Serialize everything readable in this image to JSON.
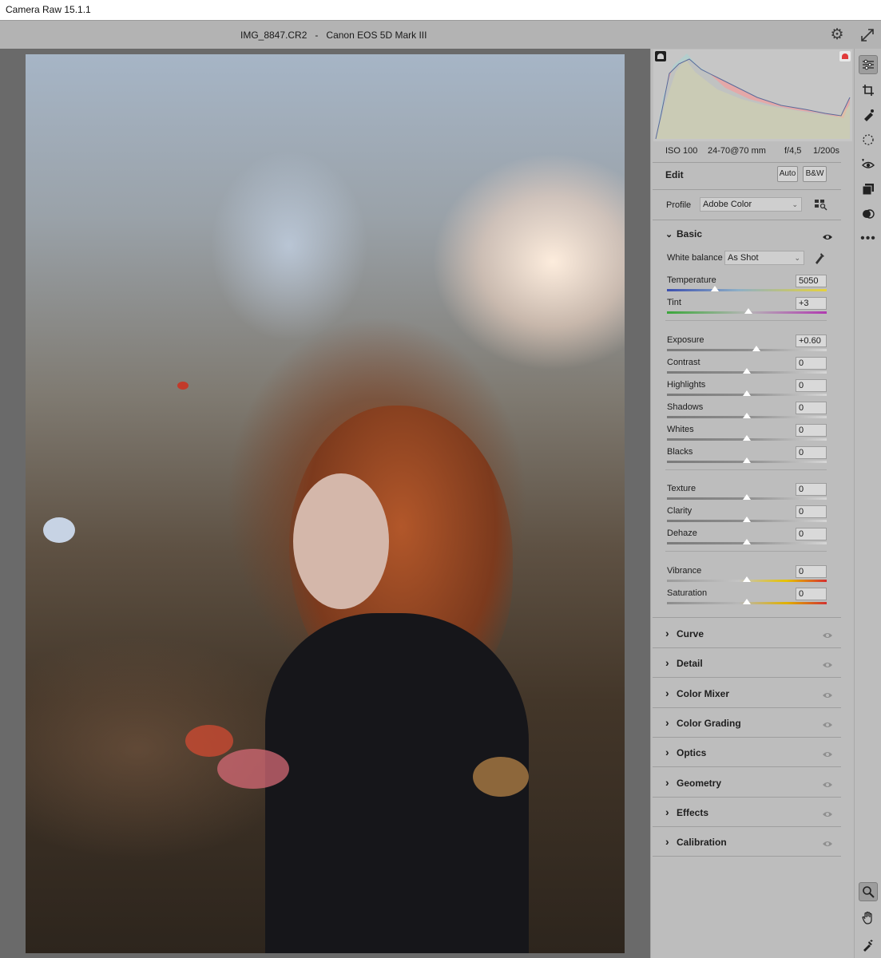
{
  "app": {
    "window_title": "Camera Raw 15.1.1"
  },
  "document": {
    "file_name": "IMG_8847.CR2",
    "separator": "-",
    "camera": "Canon EOS 5D Mark III"
  },
  "exif": {
    "iso": "ISO 100",
    "lens": "24-70@70 mm",
    "aperture": "f/4,5",
    "shutter": "1/200s"
  },
  "edit": {
    "title": "Edit",
    "auto_label": "Auto",
    "bw_label": "B&W"
  },
  "profile": {
    "label": "Profile",
    "value": "Adobe Color"
  },
  "basic": {
    "title": "Basic",
    "white_balance": {
      "label": "White balance",
      "value": "As Shot"
    },
    "sliders": [
      {
        "label": "Temperature",
        "value": "5050",
        "position": 0.3
      },
      {
        "label": "Tint",
        "value": "+3",
        "position": 0.51
      },
      {
        "label": "Exposure",
        "value": "+0.60",
        "position": 0.56
      },
      {
        "label": "Contrast",
        "value": "0",
        "position": 0.5
      },
      {
        "label": "Highlights",
        "value": "0",
        "position": 0.5
      },
      {
        "label": "Shadows",
        "value": "0",
        "position": 0.5
      },
      {
        "label": "Whites",
        "value": "0",
        "position": 0.5
      },
      {
        "label": "Blacks",
        "value": "0",
        "position": 0.5
      },
      {
        "label": "Texture",
        "value": "0",
        "position": 0.5
      },
      {
        "label": "Clarity",
        "value": "0",
        "position": 0.5
      },
      {
        "label": "Dehaze",
        "value": "0",
        "position": 0.5
      },
      {
        "label": "Vibrance",
        "value": "0",
        "position": 0.5
      },
      {
        "label": "Saturation",
        "value": "0",
        "position": 0.5
      }
    ]
  },
  "sections": [
    "Curve",
    "Detail",
    "Color Mixer",
    "Color Grading",
    "Optics",
    "Geometry",
    "Effects",
    "Calibration"
  ],
  "tools": [
    "edit-sliders-icon",
    "crop-icon",
    "healing-brush-icon",
    "masking-icon",
    "red-eye-icon",
    "presets-icon",
    "snapshots-icon",
    "more-icon",
    "zoom-icon",
    "hand-icon",
    "color-sampler-icon"
  ],
  "colors": {
    "panel_bg": "#bdbdbd",
    "canvas_bg": "#6a6a6a",
    "clip_warning": "#e03a3a"
  }
}
